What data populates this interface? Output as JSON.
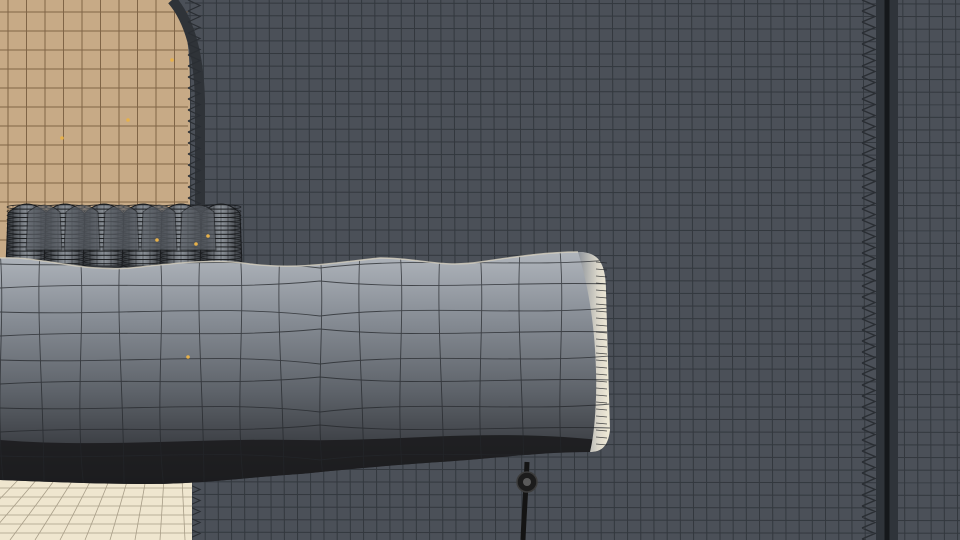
{
  "viewport": {
    "mode": "wireframe-shaded",
    "colors": {
      "background": "#4b5058",
      "grid_line": "#2b3036",
      "warm_wall": "#c7aa86",
      "warm_wall_line": "#6f5538",
      "cushion_light": "#b8bcc2",
      "cushion_mid": "#858b93",
      "cushion_dark": "#3a3e44",
      "cushion_shadow": "#1c1c1e",
      "floor": "#efe6cf",
      "floor_line": "#8a7f6a",
      "vertex_marker": "#e7b14a",
      "rope": "#141414"
    },
    "objects": [
      {
        "name": "cushion-mesh",
        "icon": "mesh-icon"
      },
      {
        "name": "spring-coils",
        "icon": "coil-icon"
      },
      {
        "name": "curtain-panel",
        "icon": "plane-icon"
      },
      {
        "name": "arched-backdrop",
        "icon": "plane-icon"
      },
      {
        "name": "hanging-rope",
        "icon": "curve-icon"
      },
      {
        "name": "floor-plane",
        "icon": "plane-icon"
      }
    ]
  }
}
